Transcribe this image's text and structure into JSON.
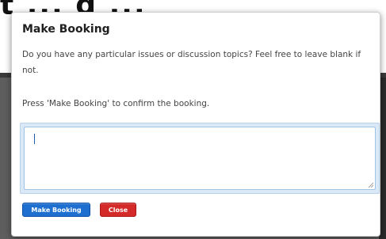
{
  "background_page": {
    "title_fragment": "t ... g ... "
  },
  "modal": {
    "title": "Make Booking",
    "prompt": "Do you have any particular issues or discussion topics? Feel free to leave blank if not.",
    "instruction": "Press 'Make Booking' to confirm the booking.",
    "textarea": {
      "value": "",
      "placeholder": ""
    },
    "buttons": {
      "make_booking": "Make Booking",
      "close": "Close"
    }
  },
  "colors": {
    "primary_button": "#1f6fd1",
    "danger_button": "#d42a2a",
    "textarea_focus": "#9ec4e8"
  }
}
